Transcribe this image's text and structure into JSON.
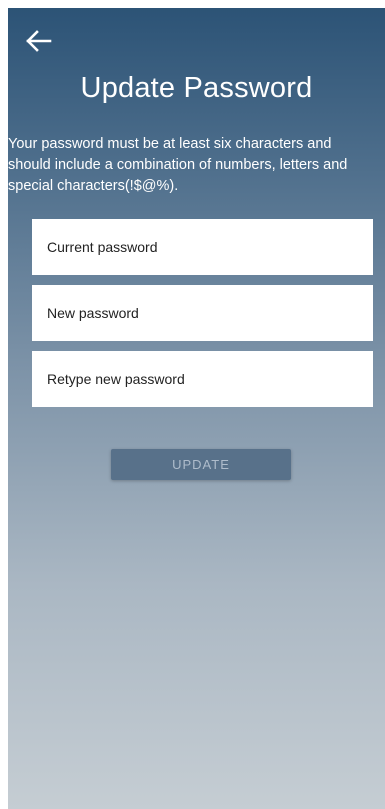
{
  "header": {
    "back_icon": "arrow-left-icon",
    "title": "Update Password"
  },
  "info_text": "Your password must be at least six characters and should include a combination of numbers, letters and special characters(!$@%).",
  "form": {
    "current_password": {
      "placeholder": "Current password",
      "value": ""
    },
    "new_password": {
      "placeholder": "New password",
      "value": ""
    },
    "retype_password": {
      "placeholder": "Retype new password",
      "value": ""
    }
  },
  "update_button": {
    "label": "UPDATE",
    "enabled": false
  },
  "colors": {
    "gradient_top": "#2c5376",
    "gradient_bottom": "#c5cdd3",
    "button_bg": "#58718a",
    "button_text": "#aebccb"
  }
}
